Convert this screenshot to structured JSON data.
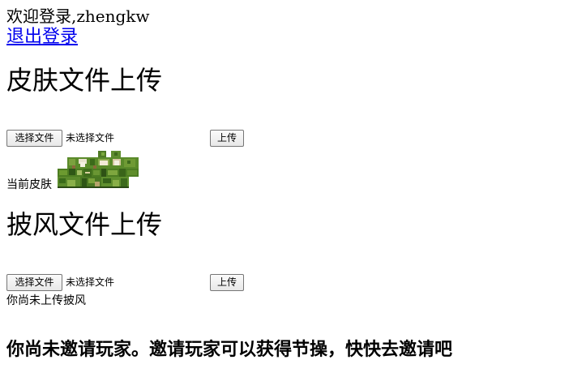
{
  "header": {
    "welcome": "欢迎登录,zhengkw",
    "logout": "退出登录"
  },
  "skin": {
    "title": "皮肤文件上传",
    "choose_label": "选择文件",
    "no_file": "未选择文件",
    "upload_label": "上传",
    "current_label": "当前皮肤"
  },
  "cape": {
    "title": "披风文件上传",
    "choose_label": "选择文件",
    "no_file": "未选择文件",
    "upload_label": "上传",
    "status": "你尚未上传披风"
  },
  "invite": {
    "message": "你尚未邀请玩家。邀请玩家可以获得节操，快快去邀请吧"
  },
  "colors": {
    "link": "#0000ee",
    "skin_green": "#5a8a2a",
    "skin_brown": "#8a6a3a"
  }
}
